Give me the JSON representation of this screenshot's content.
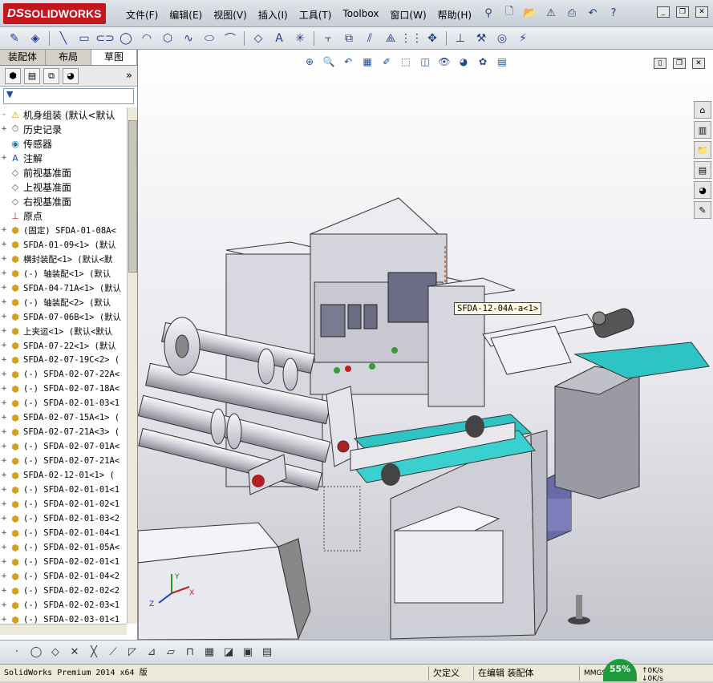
{
  "app": {
    "brand": "SOLIDWORKS",
    "brand_prefix": "DS"
  },
  "menu": [
    "文件(F)",
    "编辑(E)",
    "视图(V)",
    "插入(I)",
    "工具(T)",
    "Toolbox",
    "窗口(W)",
    "帮助(H)"
  ],
  "panel": {
    "tabs": [
      "装配体",
      "布局",
      "草图"
    ],
    "filter_icon": "filter-icon",
    "collapse": "»"
  },
  "tree": [
    {
      "label": "机身组装 (默认<默认",
      "cjk": true,
      "icon": "assembly-warning-icon",
      "expand": "-"
    },
    {
      "label": "历史记录",
      "cjk": true,
      "icon": "history-icon",
      "expand": "+"
    },
    {
      "label": "传感器",
      "cjk": true,
      "icon": "sensor-icon",
      "expand": ""
    },
    {
      "label": "注解",
      "cjk": true,
      "icon": "annotation-icon",
      "expand": "+"
    },
    {
      "label": "前视基准面",
      "cjk": true,
      "icon": "plane-icon",
      "expand": ""
    },
    {
      "label": "上视基准面",
      "cjk": true,
      "icon": "plane-icon",
      "expand": ""
    },
    {
      "label": "右视基准面",
      "cjk": true,
      "icon": "plane-icon",
      "expand": ""
    },
    {
      "label": "原点",
      "cjk": true,
      "icon": "origin-icon",
      "expand": ""
    },
    {
      "label": "(固定) SFDA-01-08A<",
      "cjk": false,
      "icon": "subassembly-icon",
      "expand": "+"
    },
    {
      "label": "SFDA-01-09<1> (默认",
      "cjk": false,
      "icon": "subassembly-icon",
      "expand": "+"
    },
    {
      "label": "横封装配<1> (默认<默",
      "cjk": false,
      "icon": "subassembly-icon",
      "expand": "+"
    },
    {
      "label": "(-) 轴装配<1> (默认",
      "cjk": false,
      "icon": "subassembly-icon",
      "expand": "+"
    },
    {
      "label": "SFDA-04-71A<1> (默认",
      "cjk": false,
      "icon": "subassembly-icon",
      "expand": "+"
    },
    {
      "label": "(-) 轴装配<2> (默认",
      "cjk": false,
      "icon": "subassembly-icon",
      "expand": "+"
    },
    {
      "label": "SFDA-07-06B<1> (默认",
      "cjk": false,
      "icon": "subassembly-icon",
      "expand": "+"
    },
    {
      "label": "上夹运<1> (默认<默认",
      "cjk": false,
      "icon": "subassembly-icon",
      "expand": "+"
    },
    {
      "label": "SFDA-07-22<1> (默认",
      "cjk": false,
      "icon": "subassembly-icon",
      "expand": "+"
    },
    {
      "label": "SFDA-02-07-19C<2> (",
      "cjk": false,
      "icon": "subassembly-icon",
      "expand": "+"
    },
    {
      "label": "(-) SFDA-02-07-22A<",
      "cjk": false,
      "icon": "subassembly-icon",
      "expand": "+"
    },
    {
      "label": "(-) SFDA-02-07-18A<",
      "cjk": false,
      "icon": "subassembly-icon",
      "expand": "+"
    },
    {
      "label": "(-) SFDA-02-01-03<1",
      "cjk": false,
      "icon": "subassembly-icon",
      "expand": "+"
    },
    {
      "label": "SFDA-02-07-15A<1> (",
      "cjk": false,
      "icon": "subassembly-icon",
      "expand": "+"
    },
    {
      "label": "SFDA-02-07-21A<3> (",
      "cjk": false,
      "icon": "subassembly-icon",
      "expand": "+"
    },
    {
      "label": "(-) SFDA-02-07-01A<",
      "cjk": false,
      "icon": "subassembly-icon",
      "expand": "+"
    },
    {
      "label": "(-) SFDA-02-07-21A<",
      "cjk": false,
      "icon": "subassembly-icon",
      "expand": "+"
    },
    {
      "label": "SFDA-02-12-01<1> (",
      "cjk": false,
      "icon": "subassembly-icon",
      "expand": "+"
    },
    {
      "label": "(-) SFDA-02-01-01<1",
      "cjk": false,
      "icon": "subassembly-icon",
      "expand": "+"
    },
    {
      "label": "(-) SFDA-02-01-02<1",
      "cjk": false,
      "icon": "subassembly-icon",
      "expand": "+"
    },
    {
      "label": "(-) SFDA-02-01-03<2",
      "cjk": false,
      "icon": "subassembly-icon",
      "expand": "+"
    },
    {
      "label": "(-) SFDA-02-01-04<1",
      "cjk": false,
      "icon": "subassembly-icon",
      "expand": "+"
    },
    {
      "label": "(-) SFDA-02-01-05A<",
      "cjk": false,
      "icon": "subassembly-icon",
      "expand": "+"
    },
    {
      "label": "(-) SFDA-02-02-01<1",
      "cjk": false,
      "icon": "subassembly-icon",
      "expand": "+"
    },
    {
      "label": "(-) SFDA-02-01-04<2",
      "cjk": false,
      "icon": "subassembly-icon",
      "expand": "+"
    },
    {
      "label": "(-) SFDA-02-02-02<2",
      "cjk": false,
      "icon": "subassembly-icon",
      "expand": "+"
    },
    {
      "label": "(-) SFDA-02-02-03<1",
      "cjk": false,
      "icon": "subassembly-icon",
      "expand": "+"
    },
    {
      "label": "(-) SFDA-02-03-01<1",
      "cjk": false,
      "icon": "subassembly-icon",
      "expand": "+"
    }
  ],
  "viewport": {
    "callout": "SFDA-12-04A-a<1>",
    "triad": {
      "x": "X",
      "y": "Y",
      "z": "Z"
    }
  },
  "status": {
    "app": "SolidWorks Premium 2014 x64 版",
    "defined": "欠定义",
    "editing": "在编辑 装配体",
    "units": "MMGS",
    "net_percent": "55%",
    "speed_up": "0K/s",
    "speed_down": "0K/s"
  },
  "colors": {
    "brand": "#c5161d",
    "belt": "#2ec4c4",
    "panel": "#6a6aa8"
  }
}
